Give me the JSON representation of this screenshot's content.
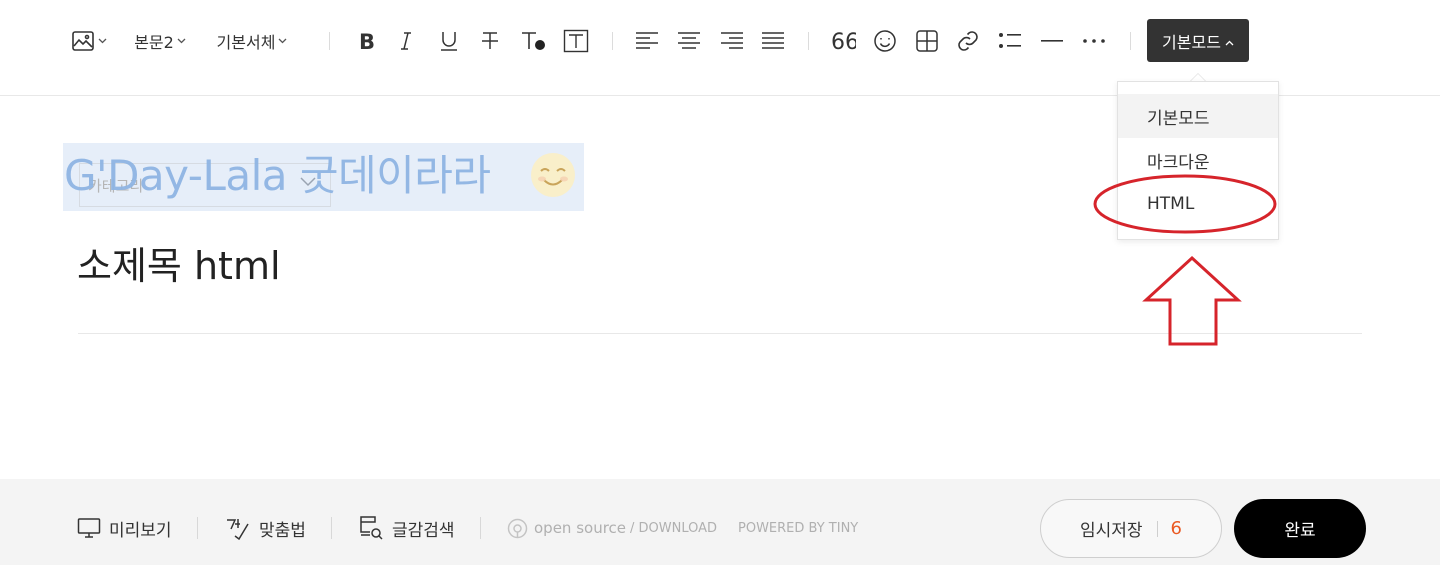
{
  "toolbar": {
    "paragraph_style": "본문2",
    "font_family": "기본서체",
    "mode_button_label": "기본모드"
  },
  "mode_menu": {
    "items": [
      {
        "label": "기본모드",
        "active": true
      },
      {
        "label": "마크다운",
        "active": false
      },
      {
        "label": "HTML",
        "active": false,
        "highlighted": true
      }
    ]
  },
  "editor": {
    "blog_title": "G'Day-Lala 굿데이라라",
    "category_placeholder": "카테고리",
    "subtitle": "소제목 html"
  },
  "footer": {
    "preview_label": "미리보기",
    "spellcheck_label": "맞춤법",
    "search_label": "글감검색",
    "open_source": "open source",
    "download": "/ DOWNLOAD",
    "powered_by": "POWERED BY TINY",
    "temp_save_label": "임시저장",
    "temp_save_count": "6",
    "done_label": "완료"
  },
  "colors": {
    "accent_dark": "#333333",
    "annotation_red": "#d6242b",
    "count_orange": "#ea5a23",
    "title_highlight": "#e6eef9"
  },
  "icons": [
    "image-icon",
    "chevron-down-icon",
    "bold-icon",
    "italic-icon",
    "underline-icon",
    "strikethrough-icon",
    "text-color-icon",
    "text-background-icon",
    "align-left-icon",
    "align-center-icon",
    "align-right-icon",
    "align-justify-icon",
    "quote-icon",
    "emoji-icon",
    "table-icon",
    "link-icon",
    "list-icon",
    "horizontal-rule-icon",
    "more-icon",
    "monitor-icon",
    "spellcheck-icon",
    "search-document-icon",
    "tiny-logo-icon"
  ]
}
